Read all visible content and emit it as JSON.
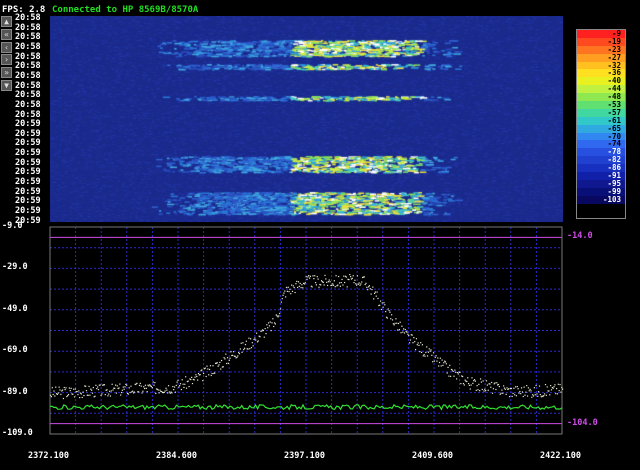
{
  "header": {
    "fps": "FPS: 2.8",
    "status": "Connected to HP 8569B/8570A"
  },
  "waterfall": {
    "timestamps": [
      "20:58",
      "20:58",
      "20:58",
      "20:58",
      "20:58",
      "20:58",
      "20:58",
      "20:58",
      "20:58",
      "20:58",
      "20:58",
      "20:59",
      "20:59",
      "20:59",
      "20:59",
      "20:59",
      "20:59",
      "20:59",
      "20:59",
      "20:59",
      "20:59",
      "20:59"
    ],
    "nav_buttons": [
      {
        "name": "nav-up-button",
        "glyph": "▲"
      },
      {
        "name": "nav-fast-back-button",
        "glyph": "«"
      },
      {
        "name": "nav-back-button",
        "glyph": "‹"
      },
      {
        "name": "nav-forward-button",
        "glyph": "›"
      },
      {
        "name": "nav-fast-forward-button",
        "glyph": "»"
      },
      {
        "name": "nav-down-button",
        "glyph": "▼"
      }
    ]
  },
  "color_scale": {
    "labels": [
      "-9",
      "-19",
      "-23",
      "-27",
      "-32",
      "-36",
      "-40",
      "-44",
      "-48",
      "-53",
      "-57",
      "-61",
      "-65",
      "-70",
      "-74",
      "-78",
      "-82",
      "-86",
      "-91",
      "-95",
      "-99",
      "-103"
    ],
    "colors": [
      "#ff2020",
      "#ff4a20",
      "#ff7420",
      "#ff9e20",
      "#ffc020",
      "#ffe020",
      "#e8f020",
      "#c0f040",
      "#90e850",
      "#60e070",
      "#40d8a0",
      "#30c8c8",
      "#30a8e0",
      "#3088f0",
      "#3068f0",
      "#2850e0",
      "#2040d0",
      "#1830c0",
      "#1020a8",
      "#101890",
      "#081078",
      "#080860"
    ]
  },
  "spectrum": {
    "y_labels": [
      "-9.0",
      "-29.0",
      "-49.0",
      "-69.0",
      "-89.0",
      "-109.0"
    ],
    "right_labels": [
      "-14.0",
      "-104.0"
    ],
    "x_labels": [
      "2372.100",
      "2384.600",
      "2397.100",
      "2409.600",
      "2422.100"
    ],
    "colors": {
      "grid": "#2a2ad0",
      "background": "#000000",
      "trace_peak": "#e8e8d0",
      "trace_noise": "#33e033",
      "reference_lines": "#d04ce8"
    }
  },
  "chart_data": {
    "type": "line",
    "xlabel": "",
    "ylabel": "",
    "xlim": [
      2372.1,
      2422.1
    ],
    "ylim": [
      -109,
      -9
    ],
    "reference_levels": [
      -14,
      -104
    ],
    "series": [
      {
        "x": [
          2372.1,
          2376,
          2380,
          2384,
          2386,
          2388,
          2390,
          2392,
          2394,
          2395,
          2397,
          2399,
          2401,
          2402,
          2403,
          2405,
          2407,
          2409,
          2411,
          2413,
          2415,
          2417,
          2420,
          2422.1
        ],
        "values": [
          -89,
          -88,
          -87,
          -86,
          -83,
          -77,
          -70,
          -63,
          -55,
          -40,
          -35,
          -35,
          -35,
          -34,
          -36,
          -50,
          -62,
          -70,
          -78,
          -84,
          -86,
          -88,
          -88,
          -87
        ]
      },
      {
        "x": [
          2372.1,
          2380,
          2390,
          2400,
          2410,
          2422.1
        ],
        "values": [
          -96,
          -96.5,
          -96,
          -96.5,
          -96,
          -96
        ]
      }
    ]
  }
}
